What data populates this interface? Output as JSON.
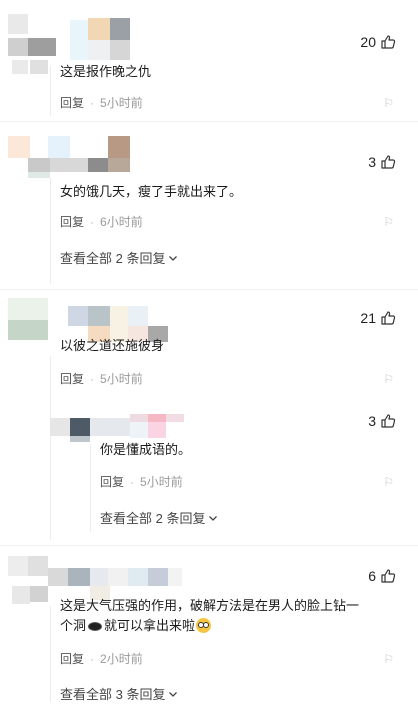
{
  "comments": [
    {
      "likes": "20",
      "text": "这是报作晚之仇",
      "reply_label": "回复",
      "time": "5小时前",
      "flag": "⚐"
    },
    {
      "likes": "3",
      "text": "女的饿几天，瘦了手就出来了。",
      "reply_label": "回复",
      "time": "6小时前",
      "flag": "⚐",
      "expand_label": "查看全部 2 条回复"
    },
    {
      "likes": "21",
      "text": "以彼之道还施彼身",
      "reply_label": "回复",
      "time": "5小时前",
      "flag": "⚐",
      "reply": {
        "likes": "3",
        "text": "你是懂成语的。",
        "reply_label": "回复",
        "time": "5小时前",
        "flag": "⚐",
        "expand_label": "查看全部 2 条回复"
      }
    },
    {
      "likes": "6",
      "text_line1": "这是大气压强的作用，破解方法是在男人的脸上钻一",
      "text_line2a": "个洞",
      "text_line2b": "就可以拿出来啦",
      "reply_label": "回复",
      "time": "2小时前",
      "flag": "⚐",
      "expand_label": "查看全部 3 条回复"
    }
  ],
  "separator": "·",
  "icons": {
    "like": "thumbs-up-icon",
    "expand": "chevron-down-icon",
    "flag": "flag-icon",
    "emoji1": "hole-emoji-icon",
    "emoji2": "surprised-face-emoji-icon"
  },
  "colors": {
    "meta": "#9a9a9a",
    "text": "#1a1a1a"
  }
}
